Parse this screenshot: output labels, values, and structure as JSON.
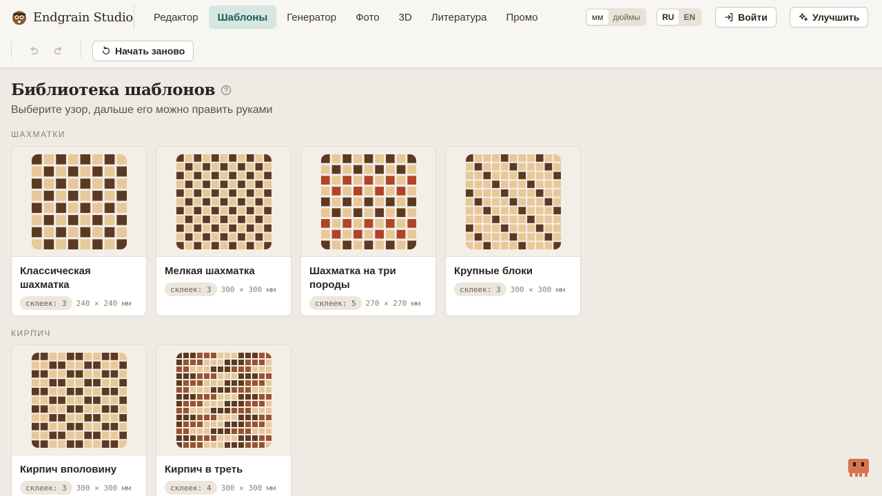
{
  "app": {
    "name": "Endgrain Studio",
    "logo_icon": "beaver-logo-icon"
  },
  "nav": {
    "tabs": [
      {
        "label": "Редактор",
        "active": false
      },
      {
        "label": "Шаблоны",
        "active": true
      },
      {
        "label": "Генератор",
        "active": false
      },
      {
        "label": "Фото",
        "active": false
      },
      {
        "label": "3D",
        "active": false
      },
      {
        "label": "Литература",
        "active": false
      },
      {
        "label": "Промо",
        "active": false
      }
    ]
  },
  "units": {
    "options": [
      "мм",
      "дюймы"
    ],
    "selected": "мм"
  },
  "language": {
    "options": [
      "RU",
      "EN"
    ],
    "selected": "RU"
  },
  "header_buttons": {
    "login": "Войти",
    "upgrade": "Улучшить"
  },
  "toolbar": {
    "restart": "Начать заново",
    "undo_icon": "undo-icon",
    "redo_icon": "redo-icon"
  },
  "page": {
    "title": "Библиотека шаблонов",
    "subtitle": "Выберите узор, дальше его можно править руками"
  },
  "colors": {
    "dark": "#5c3a22",
    "light": "#e8c898",
    "red": "#b04428",
    "rust": "#9a5230",
    "accent": "#1e5c54"
  },
  "sections": [
    {
      "label": "ШАХМАТКИ",
      "cards": [
        {
          "name": "Классическая шахматка",
          "chip": "склеек: 3",
          "dims": "240 × 240 мм",
          "pattern": "classic"
        },
        {
          "name": "Мелкая шахматка",
          "chip": "склеек: 3",
          "dims": "300 × 300 мм",
          "pattern": "fine"
        },
        {
          "name": "Шахматка на три породы",
          "chip": "склеек: 5",
          "dims": "270 × 270 мм",
          "pattern": "three"
        },
        {
          "name": "Крупные блоки",
          "chip": "склеек: 3",
          "dims": "300 × 300 мм",
          "pattern": "blocks"
        }
      ]
    },
    {
      "label": "КИРПИЧ",
      "cards": [
        {
          "name": "Кирпич вполовину",
          "chip": "склеек: 3",
          "dims": "300 × 300 мм",
          "pattern": "brick-half"
        },
        {
          "name": "Кирпич в треть",
          "chip": "склеек: 4",
          "dims": "300 × 300 мм",
          "pattern": "brick-third"
        }
      ]
    }
  ]
}
